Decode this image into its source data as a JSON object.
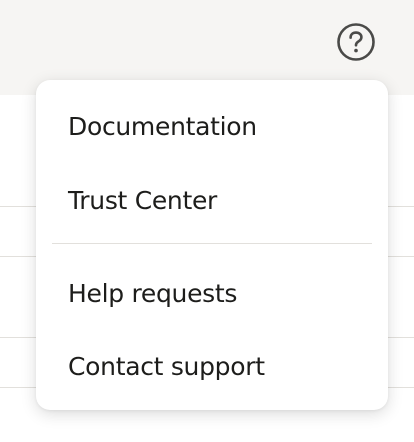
{
  "header": {
    "help_icon": "question-circle-icon"
  },
  "help_menu": {
    "items": [
      {
        "label": "Documentation"
      },
      {
        "label": "Trust Center"
      },
      {
        "label": "Help requests"
      },
      {
        "label": "Contact support"
      }
    ]
  },
  "colors": {
    "topbar_background": "#f6f5f3",
    "menu_background": "#ffffff",
    "text": "#1d1d1b",
    "icon": "#4a4a48",
    "divider": "#e2e0dc"
  }
}
